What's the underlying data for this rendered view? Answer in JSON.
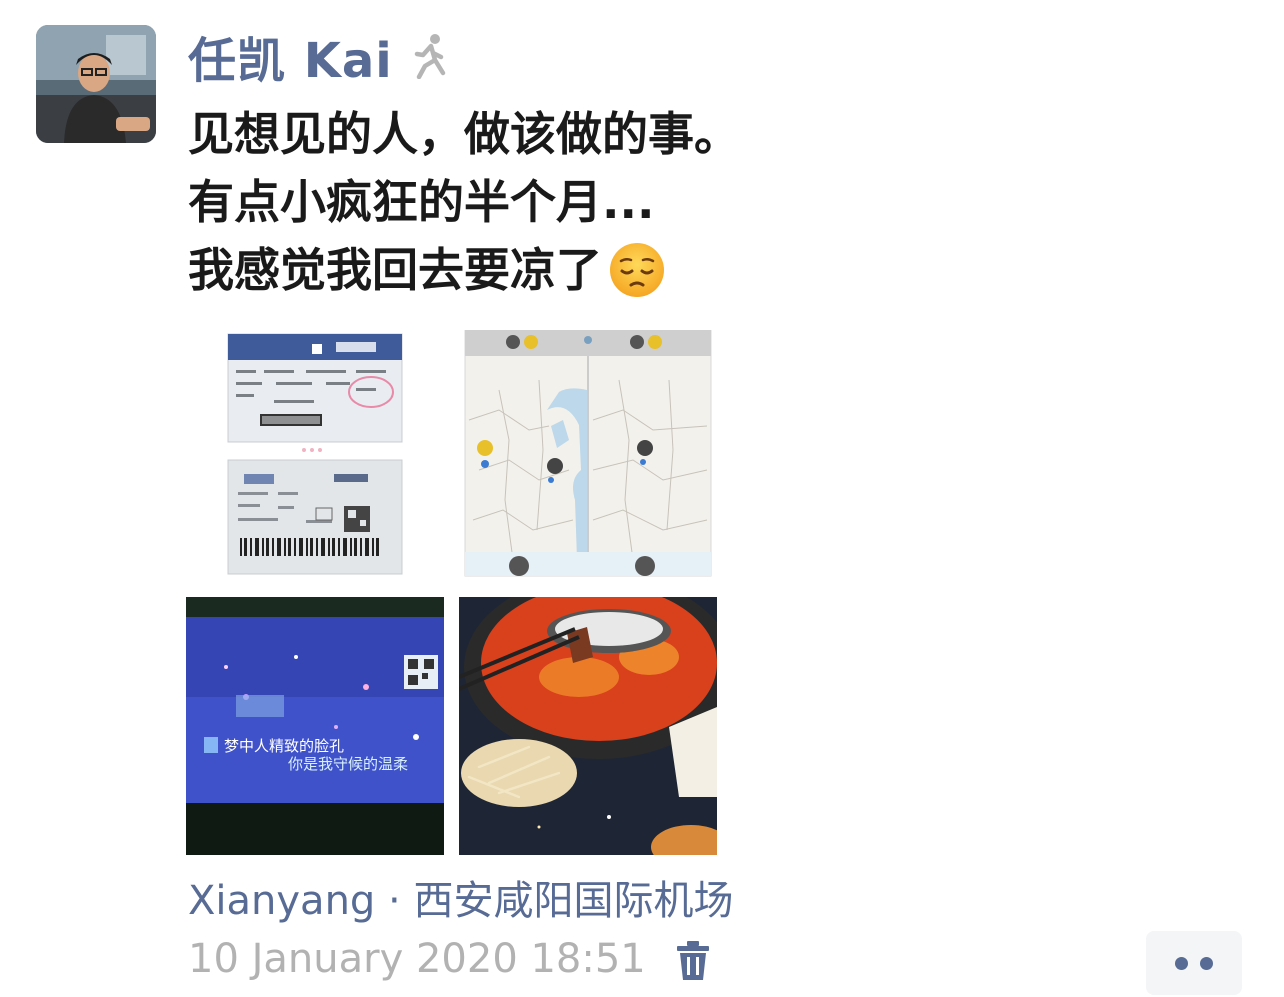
{
  "post": {
    "author": "任凯 Kai",
    "status_icon": "walking-person-icon",
    "text_lines": [
      "见想见的人，做该做的事。",
      "有点小疯狂的半个月...",
      "我感觉我回去要凉了"
    ],
    "emoji": "pensive-face-emoji",
    "photos": [
      {
        "name": "boarding-passes-photo"
      },
      {
        "name": "map-screenshot-photo"
      },
      {
        "name": "karaoke-screen-photo",
        "caption_lines": [
          "梦中人精致的脸孔",
          "你是我守候的温柔"
        ]
      },
      {
        "name": "hotpot-photo"
      }
    ],
    "location": "Xianyang · 西安咸阳国际机场",
    "timestamp": "10 January 2020 18:51",
    "actions": {
      "delete_icon": "trash-icon",
      "more_icon": "more-dots-icon"
    },
    "colors": {
      "link": "#576b95",
      "text": "#1a1a1a",
      "meta": "#b2b2b2",
      "more_bg": "#f4f5f7"
    }
  }
}
